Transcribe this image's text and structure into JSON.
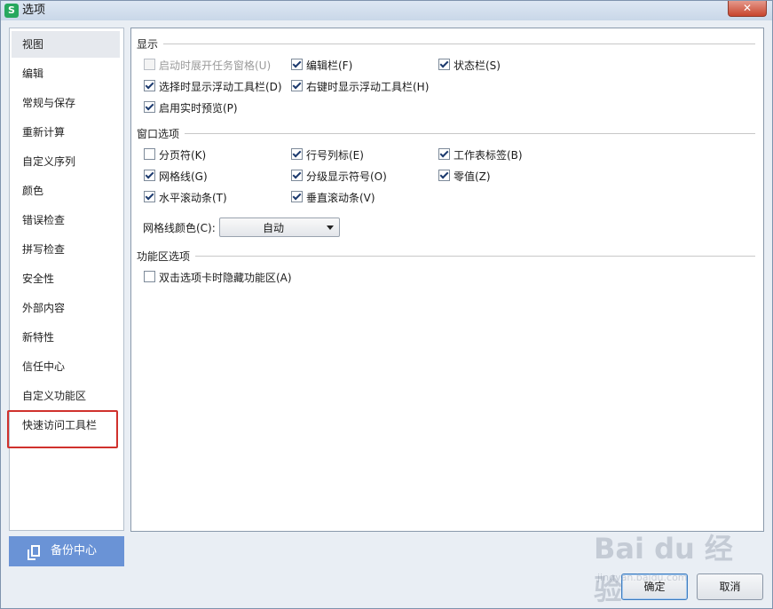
{
  "window": {
    "title": "选项",
    "app_icon": "S",
    "close": "✕"
  },
  "sidebar": {
    "items": [
      {
        "label": "视图"
      },
      {
        "label": "编辑"
      },
      {
        "label": "常规与保存"
      },
      {
        "label": "重新计算"
      },
      {
        "label": "自定义序列"
      },
      {
        "label": "颜色"
      },
      {
        "label": "错误检查"
      },
      {
        "label": "拼写检查"
      },
      {
        "label": "安全性"
      },
      {
        "label": "外部内容"
      },
      {
        "label": "新特性"
      },
      {
        "label": "信任中心"
      },
      {
        "label": "自定义功能区"
      },
      {
        "label": "快速访问工具栏"
      }
    ],
    "active_index": 0,
    "highlighted_index": 13,
    "backup_label": "备份中心"
  },
  "display": {
    "title": "显示",
    "options": [
      {
        "label": "启动时展开任务窗格(U)",
        "checked": false,
        "disabled": true
      },
      {
        "label": "编辑栏(F)",
        "checked": true
      },
      {
        "label": "状态栏(S)",
        "checked": true
      },
      {
        "label": "选择时显示浮动工具栏(D)",
        "checked": true
      },
      {
        "label": "右键时显示浮动工具栏(H)",
        "checked": true
      },
      {
        "label": "启用实时预览(P)",
        "checked": true
      }
    ]
  },
  "window_options": {
    "title": "窗口选项",
    "options": [
      {
        "label": "分页符(K)",
        "checked": false
      },
      {
        "label": "行号列标(E)",
        "checked": true
      },
      {
        "label": "工作表标签(B)",
        "checked": true
      },
      {
        "label": "网格线(G)",
        "checked": true
      },
      {
        "label": "分级显示符号(O)",
        "checked": true
      },
      {
        "label": "零值(Z)",
        "checked": true
      },
      {
        "label": "水平滚动条(T)",
        "checked": true
      },
      {
        "label": "垂直滚动条(V)",
        "checked": true
      }
    ],
    "gridline_color_label": "网格线颜色(C):",
    "gridline_color_value": "自动"
  },
  "ribbon_options": {
    "title": "功能区选项",
    "options": [
      {
        "label": "双击选项卡时隐藏功能区(A)",
        "checked": false
      }
    ]
  },
  "buttons": {
    "ok": "确定",
    "cancel": "取消"
  },
  "watermark": {
    "main": "Bai du 经验",
    "sub": "jingyan.baidu.com"
  },
  "colors": {
    "accent": "#6a93d6",
    "highlight": "#d0312d"
  }
}
